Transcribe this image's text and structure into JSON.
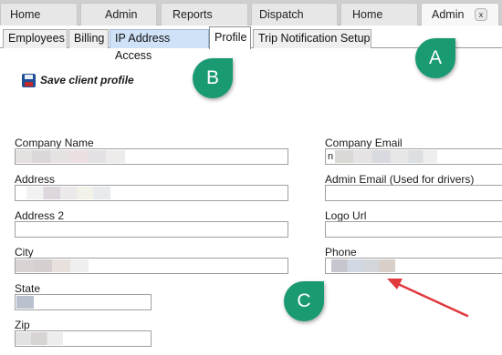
{
  "top_tabs": [
    "Home",
    "Admin",
    "Reports",
    "Dispatch",
    "Home",
    "Admin"
  ],
  "close_glyph": "x",
  "sub_tabs": [
    "Employees",
    "Billing",
    "IP Address Access",
    "Profile",
    "Trip Notification Setup"
  ],
  "save_label": "Save client profile",
  "fields": {
    "company_name": "Company Name",
    "address": "Address",
    "address2": "Address 2",
    "city": "City",
    "state": "State",
    "zip": "Zip",
    "company_email": "Company Email",
    "company_email_value_start": "n",
    "admin_email": "Admin Email (Used for drivers)",
    "logo_url": "Logo Url",
    "phone": "Phone"
  },
  "callouts": {
    "a": "A",
    "b": "B",
    "c": "C"
  },
  "colors": {
    "callout": "#1a9a72",
    "arrow": "#e0393e",
    "tab_highlight": "#cfe2f7"
  }
}
